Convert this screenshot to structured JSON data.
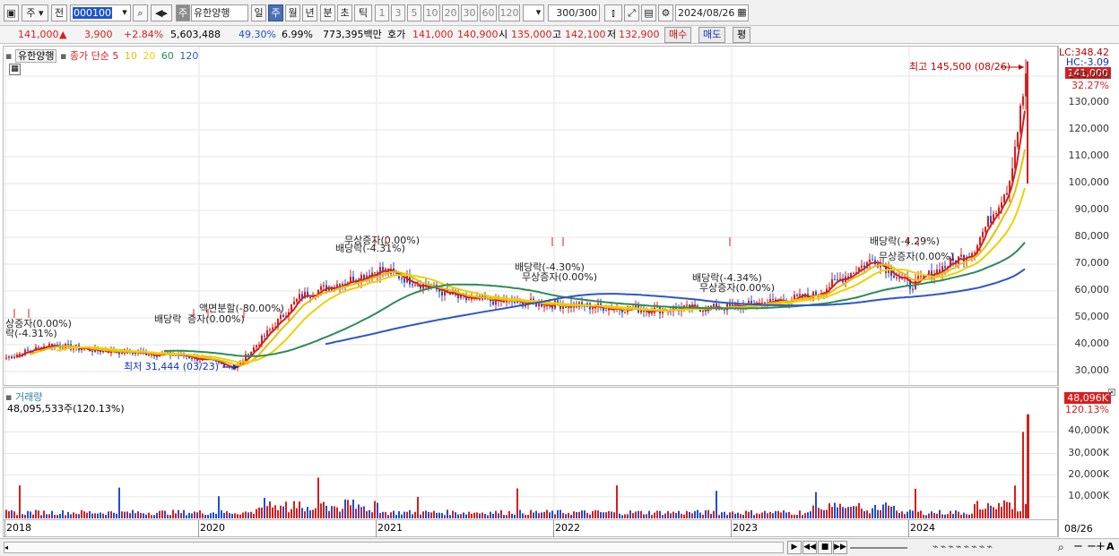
{
  "toolbar": {
    "market": "주",
    "prefix": "전",
    "code": "000100",
    "stock_badge": "주",
    "stock_name": "유한양행",
    "periods": [
      "일",
      "주",
      "월",
      "년",
      "분",
      "초",
      "틱"
    ],
    "active_period": "주",
    "minute_options": [
      "1",
      "3",
      "5",
      "10",
      "20",
      "30",
      "60",
      "120"
    ],
    "count": "300",
    "count_total": "/300",
    "date": "2024/08/26"
  },
  "quote": {
    "price": "141,000",
    "change_arrow": "▲",
    "change": "3,900",
    "change_pct": "+2.84%",
    "volume": "5,603,488",
    "pct_a": "49.30%",
    "pct_b": "6.99%",
    "amount": "773,395백만",
    "hoga_label": "호가",
    "ask": "141,000",
    "bid": "140,900",
    "open_label": "시",
    "open": "135,000",
    "high_label": "고",
    "high": "142,100",
    "low_label": "저",
    "low": "132,900",
    "buy_label": "매수",
    "sell_label": "매도",
    "eval_label": "평"
  },
  "price_panel": {
    "stock_tag": "유한양행",
    "legend_main": "종가 단순 5",
    "ma_labels": [
      {
        "label": "10",
        "color": "#e8c000"
      },
      {
        "label": "20",
        "color": "#f0d000"
      },
      {
        "label": "60",
        "color": "#2e8b57"
      },
      {
        "label": "120",
        "color": "#2f55c8"
      }
    ],
    "lc": "LC:348.42",
    "hc": "HC:-3.09",
    "current_tag": "141,000",
    "current_pct": "32.27%",
    "y_ticks": [
      "140,000",
      "130,000",
      "120,000",
      "110,000",
      "100,000",
      "90,000",
      "80,000",
      "70,000",
      "60,000",
      "50,000",
      "40,000",
      "30,000"
    ],
    "high_note": "최고 145,500 (08/26)",
    "low_note": "최저 31,444 (03/23)",
    "events": [
      "상증자(0.00%)",
      "락(-4.31%)",
      "배당락",
      "증자(0.00%)",
      "액면분할(-80.00%)",
      "무상증자(0.00%)",
      "배당락(-4.31%)",
      "배당락(-4.30%)",
      "무상증자(0.00%)",
      "배당락(-4.34%)",
      "무상증자(0.00%)",
      "배당락(-4.29%)",
      "무상증자(0.00%)"
    ]
  },
  "volume_panel": {
    "title": "거래량",
    "value_text": "48,095,533주(120.13%)",
    "tag": "48,096K",
    "tag_pct": "120.13%",
    "y_ticks": [
      "40,000K",
      "30,000K",
      "20,000K",
      "10,000K"
    ]
  },
  "x_axis": {
    "labels": [
      "2018",
      "2020",
      "2021",
      "2022",
      "2023",
      "2024"
    ],
    "right_label": "08/26"
  },
  "chart_data": {
    "type": "candlestick",
    "interval": "weekly",
    "title": "유한양행",
    "x_range": [
      "2018",
      "2024/08/26"
    ],
    "ylim": [
      25000,
      150000
    ],
    "series": [
      {
        "name": "종가 단순 5",
        "color": "#d81e1e"
      },
      {
        "name": "10",
        "color": "#e8c000"
      },
      {
        "name": "20",
        "color": "#f0d000"
      },
      {
        "name": "60",
        "color": "#2e8b57"
      },
      {
        "name": "120",
        "color": "#2f55c8"
      }
    ],
    "approx_close": [
      {
        "x": "2018",
        "y": 35000
      },
      {
        "x": "2018-mid",
        "y": 40000
      },
      {
        "x": "2019",
        "y": 38000
      },
      {
        "x": "2020",
        "y": 36000
      },
      {
        "x": "2020-03",
        "y": 31444
      },
      {
        "x": "2020-08",
        "y": 58000
      },
      {
        "x": "2021-01",
        "y": 68000
      },
      {
        "x": "2021-06",
        "y": 57000
      },
      {
        "x": "2022",
        "y": 55000
      },
      {
        "x": "2022-06",
        "y": 53000
      },
      {
        "x": "2023",
        "y": 54000
      },
      {
        "x": "2023-06",
        "y": 58000
      },
      {
        "x": "2023-10",
        "y": 72000
      },
      {
        "x": "2024-01",
        "y": 62000
      },
      {
        "x": "2024-05",
        "y": 75000
      },
      {
        "x": "2024-07",
        "y": 100000
      },
      {
        "x": "2024-08-26",
        "y": 141000
      }
    ],
    "extremes": {
      "high": 145500,
      "high_date": "08/26",
      "low": 31444,
      "low_date": "03/23"
    },
    "volume_last": 48095533
  }
}
